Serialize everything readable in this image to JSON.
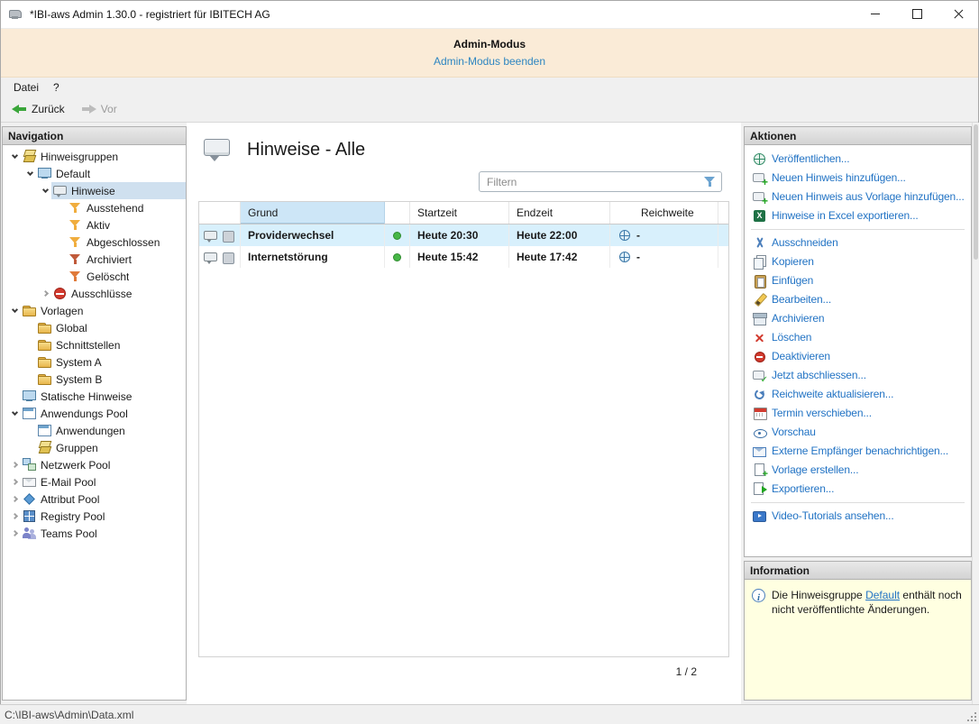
{
  "colors": {
    "accent_link": "#2273c4",
    "selection_blue": "#d8f0fc",
    "selected_tree": "#cfe0ef",
    "banner_bg": "#faebd7",
    "info_bg": "#ffffe1",
    "grund_header_bg": "#cde6f7",
    "status_green": "#47b747"
  },
  "window": {
    "title": "*IBI-aws Admin 1.30.0 - registriert für IBITECH AG",
    "controls": [
      "minimize",
      "maximize",
      "close"
    ]
  },
  "banner": {
    "title": "Admin-Modus",
    "link": "Admin-Modus beenden"
  },
  "menu": {
    "items": [
      "Datei",
      "?"
    ]
  },
  "toolbar": {
    "back": "Zurück",
    "forward": "Vor"
  },
  "navigation": {
    "header": "Navigation",
    "tree": [
      {
        "label": "Hinweisgruppen",
        "level": 0,
        "state": "expanded",
        "icon": "group-stack"
      },
      {
        "label": "Default",
        "level": 1,
        "state": "expanded",
        "icon": "monitor"
      },
      {
        "label": "Hinweise",
        "level": 2,
        "state": "expanded",
        "icon": "note",
        "selected": true
      },
      {
        "label": "Ausstehend",
        "level": 3,
        "state": "leaf",
        "icon": "funnel",
        "color": "#f0ad3e"
      },
      {
        "label": "Aktiv",
        "level": 3,
        "state": "leaf",
        "icon": "funnel",
        "color": "#f0ad3e"
      },
      {
        "label": "Abgeschlossen",
        "level": 3,
        "state": "leaf",
        "icon": "funnel",
        "color": "#f0ad3e"
      },
      {
        "label": "Archiviert",
        "level": 3,
        "state": "leaf",
        "icon": "funnel",
        "color": "#c05a3a"
      },
      {
        "label": "Gelöscht",
        "level": 3,
        "state": "leaf",
        "icon": "funnel",
        "color": "#e07a3a"
      },
      {
        "label": "Ausschlüsse",
        "level": 2,
        "state": "collapsed",
        "icon": "block"
      },
      {
        "label": "Vorlagen",
        "level": 0,
        "state": "expanded",
        "icon": "folder"
      },
      {
        "label": "Global",
        "level": 1,
        "state": "leaf",
        "icon": "folder"
      },
      {
        "label": "Schnittstellen",
        "level": 1,
        "state": "leaf",
        "icon": "folder"
      },
      {
        "label": "System A",
        "level": 1,
        "state": "leaf",
        "icon": "folder"
      },
      {
        "label": "System B",
        "level": 1,
        "state": "leaf",
        "icon": "folder"
      },
      {
        "label": "Statische Hinweise",
        "level": 0,
        "state": "leaf",
        "icon": "monitor"
      },
      {
        "label": "Anwendungs Pool",
        "level": 0,
        "state": "expanded",
        "icon": "window"
      },
      {
        "label": "Anwendungen",
        "level": 1,
        "state": "leaf",
        "icon": "window"
      },
      {
        "label": "Gruppen",
        "level": 1,
        "state": "leaf",
        "icon": "group-stack"
      },
      {
        "label": "Netzwerk Pool",
        "level": 0,
        "state": "collapsed",
        "icon": "network"
      },
      {
        "label": "E-Mail Pool",
        "level": 0,
        "state": "collapsed",
        "icon": "mail"
      },
      {
        "label": "Attribut Pool",
        "level": 0,
        "state": "collapsed",
        "icon": "attribute"
      },
      {
        "label": "Registry Pool",
        "level": 0,
        "state": "collapsed",
        "icon": "registry"
      },
      {
        "label": "Teams Pool",
        "level": 0,
        "state": "collapsed",
        "icon": "teams"
      }
    ]
  },
  "content": {
    "title": "Hinweise - Alle",
    "filter": {
      "placeholder": "Filtern",
      "icon": "filter-funnel"
    },
    "table": {
      "columns": {
        "grund": "Grund",
        "startzeit": "Startzeit",
        "endzeit": "Endzeit",
        "reichweite": "Reichweite"
      },
      "rows": [
        {
          "grund": "Providerwechsel",
          "status": "aktiv",
          "startzeit": "Heute 20:30",
          "endzeit": "Heute 22:00",
          "reichweite": "-",
          "selected": true
        },
        {
          "grund": "Internetstörung",
          "status": "aktiv",
          "startzeit": "Heute 15:42",
          "endzeit": "Heute 17:42",
          "reichweite": "-",
          "selected": false
        }
      ]
    },
    "pager": "1 / 2"
  },
  "actions": {
    "header": "Aktionen",
    "items": [
      {
        "label": "Veröffentlichen...",
        "icon": "publish"
      },
      {
        "label": "Neuen Hinweis hinzufügen...",
        "icon": "add-note"
      },
      {
        "label": "Neuen Hinweis aus Vorlage hinzufügen...",
        "icon": "add-from-template"
      },
      {
        "label": "Hinweise in Excel exportieren...",
        "icon": "excel"
      },
      {
        "divider": true
      },
      {
        "label": "Ausschneiden",
        "icon": "cut"
      },
      {
        "label": "Kopieren",
        "icon": "copy"
      },
      {
        "label": "Einfügen",
        "icon": "paste"
      },
      {
        "label": "Bearbeiten...",
        "icon": "edit"
      },
      {
        "label": "Archivieren",
        "icon": "archive"
      },
      {
        "label": "Löschen",
        "icon": "delete"
      },
      {
        "label": "Deaktivieren",
        "icon": "deactivate"
      },
      {
        "label": "Jetzt abschliessen...",
        "icon": "finish"
      },
      {
        "label": "Reichweite aktualisieren...",
        "icon": "refresh"
      },
      {
        "label": "Termin verschieben...",
        "icon": "calendar"
      },
      {
        "label": "Vorschau",
        "icon": "preview"
      },
      {
        "label": "Externe Empfänger benachrichtigen...",
        "icon": "notify"
      },
      {
        "label": "Vorlage erstellen...",
        "icon": "template"
      },
      {
        "label": "Exportieren...",
        "icon": "export"
      },
      {
        "divider": true
      },
      {
        "label": "Video-Tutorials ansehen...",
        "icon": "video"
      }
    ]
  },
  "information": {
    "header": "Information",
    "text_before": "Die Hinweisgruppe ",
    "link": "Default",
    "text_after": " enthält noch nicht veröffentlichte Änderungen."
  },
  "statusbar": {
    "path": "C:\\IBI-aws\\Admin\\Data.xml"
  }
}
